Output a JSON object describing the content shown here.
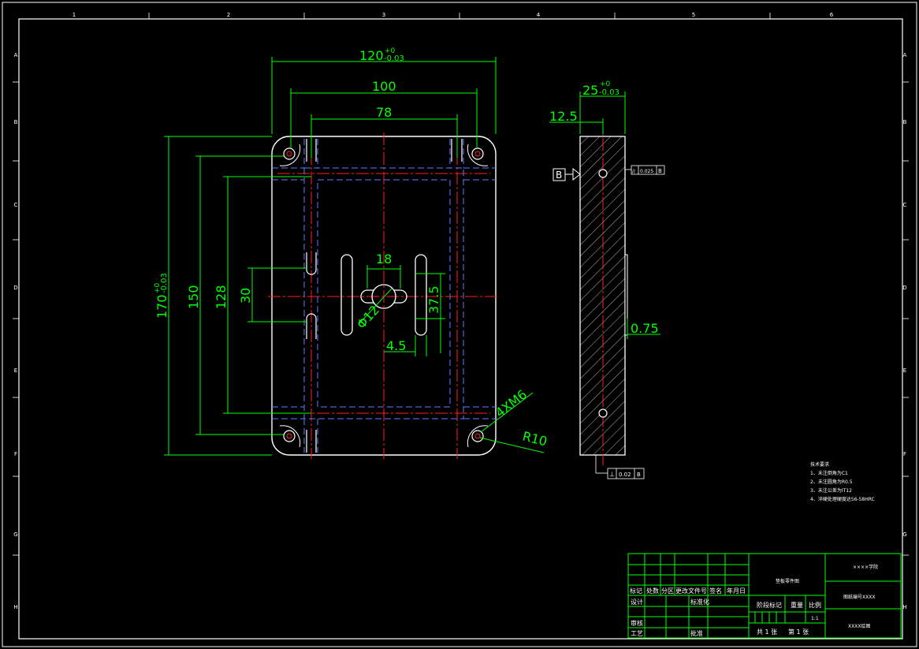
{
  "colors": {
    "background": "#000000",
    "border": "#ffffff",
    "outline": "#ffffff",
    "dimension": "#00ff00",
    "center_line": "#ff2020",
    "hidden_line": "#5b7bff",
    "hatch": "#ffffff",
    "title_block": "#00ff00",
    "text": "#ffffff",
    "hole_red": "#ff2020"
  },
  "border_zones": {
    "top": [
      "1",
      "2",
      "3",
      "4",
      "5",
      "6"
    ],
    "side": [
      "A",
      "B",
      "C",
      "D",
      "E",
      "F",
      "G",
      "H"
    ]
  },
  "dimensions": {
    "width_120": "120",
    "width_120_tol_upper": "+0",
    "width_120_tol_lower": "-0.03",
    "width_100": "100",
    "width_78": "78",
    "height_170": "170",
    "height_170_tol_upper": "+0",
    "height_170_tol_lower": "-0.03",
    "height_150": "150",
    "height_128": "128",
    "height_30": "30",
    "slot_18": "18",
    "slot_37_5": "37.5",
    "slot_4_5": "4.5",
    "hole_phi12": "Φ12",
    "thread": "4XM6",
    "radius": "R10",
    "thickness_25": "25",
    "thickness_25_tol_upper": "+0",
    "thickness_25_tol_lower": "-0.03",
    "offset_12_5": "12.5",
    "depth_0_75": "0.75"
  },
  "datum": {
    "label": "B",
    "parallelism_symbol": "//",
    "parallelism_value": "0.025",
    "parallelism_ref": "B",
    "perpendicularity_symbol": "⊥",
    "perpendicularity_value": "0.02",
    "perpendicularity_ref": "B"
  },
  "notes": {
    "title": "技术要求",
    "items": [
      "1、未注倒角为C1",
      "2、未注圆角为R0.5",
      "3、未注公差为IT12",
      "4、淬硬处理硬度达56-58HRC"
    ]
  },
  "title_block": {
    "school": "××××学院",
    "part_name": "垫板零件图",
    "drawing_no": "图纸编号XXXX",
    "drawn_by": "XXXX绘图",
    "headers": [
      "标记",
      "处数",
      "分区",
      "更改文件号",
      "签名",
      "年月日"
    ],
    "design": "设计",
    "standardization": "标准化",
    "review": "审核",
    "process": "工艺",
    "approve": "批准",
    "stage_mark": "阶段标记",
    "weight": "重量",
    "scale": "比例",
    "scale_value": "1:1",
    "total": "共 1 张",
    "sheet": "第 1 张"
  }
}
